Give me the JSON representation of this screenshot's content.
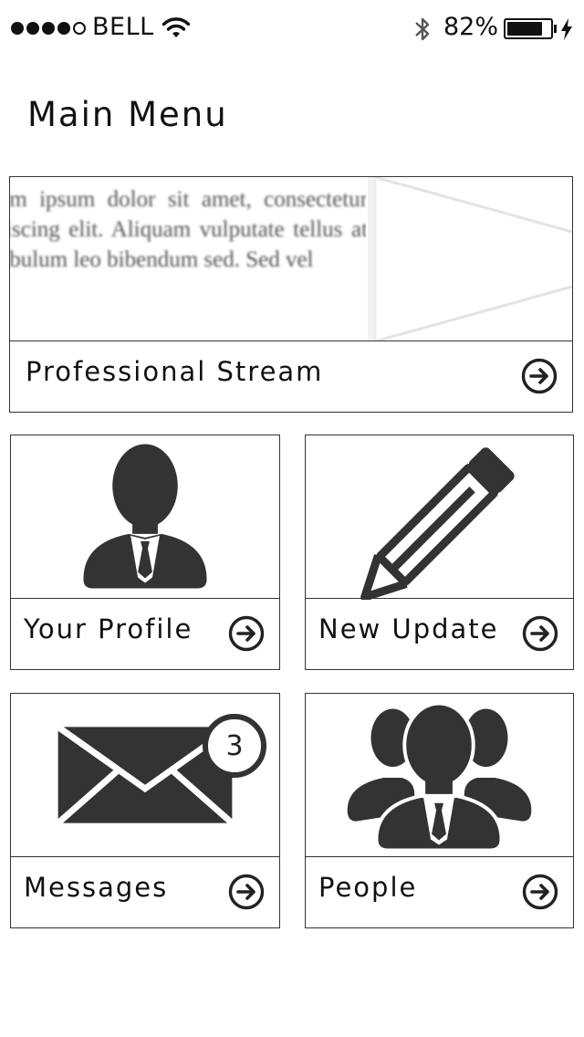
{
  "status_bar": {
    "carrier": "BELL",
    "battery_percent": "82%",
    "battery_level": 0.82,
    "signal_strength": 4,
    "signal_max": 5,
    "icons": [
      "wifi-icon",
      "bluetooth-icon",
      "battery-icon",
      "charging-bolt-icon"
    ]
  },
  "header": {
    "title": "Main Menu"
  },
  "stream": {
    "label": "Professional Stream",
    "preview_text": "Lorem ipsum dolor sit amet, consectetur adipiscing elit. Aliquam vulputate tellus at vestibulum leo bibendum sed. Sed vel",
    "icon": "arrow-circle-right-icon"
  },
  "tiles": [
    {
      "label": "Your Profile",
      "icon": "person-icon"
    },
    {
      "label": "New Update",
      "icon": "pencil-icon"
    },
    {
      "label": "Messages",
      "icon": "envelope-icon",
      "badge": "3"
    },
    {
      "label": "People",
      "icon": "group-icon"
    }
  ],
  "colors": {
    "icon": "#333333",
    "border": "#333333",
    "background": "#ffffff"
  }
}
